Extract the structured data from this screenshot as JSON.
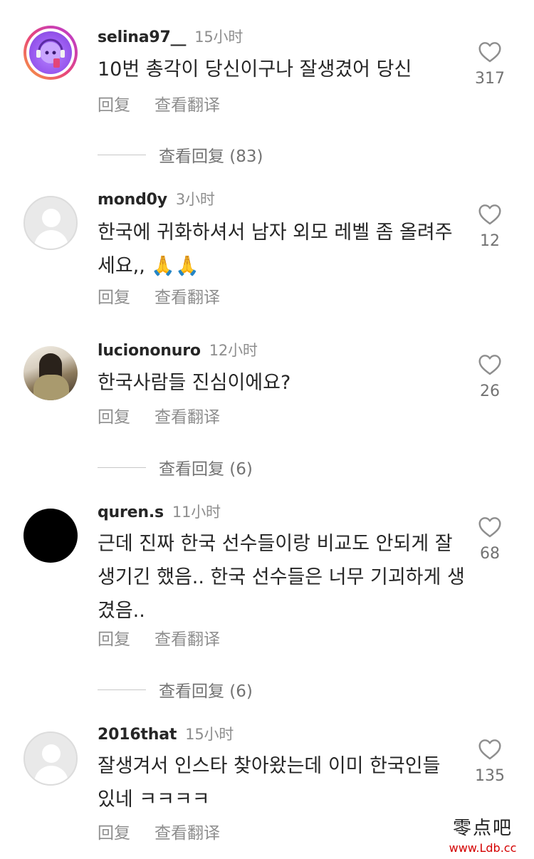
{
  "comments": [
    {
      "username": "selina97__",
      "time": "15小时",
      "text": "10번 총각이 당신이구나 잘생겼어 당신",
      "likes": "317",
      "reply_label": "回复",
      "translate_label": "查看翻译",
      "view_replies": "查看回复 (83)",
      "avatar_style": "purple-character-with-story-ring"
    },
    {
      "username": "mond0y",
      "time": "3小时",
      "text": "한국에 귀화하셔서 남자 외모 레벨 좀 올려주세요,, 🙏🙏",
      "likes": "12",
      "reply_label": "回复",
      "translate_label": "查看翻译",
      "avatar_style": "default-profile"
    },
    {
      "username": "luciononuro",
      "time": "12小时",
      "text": "한국사람들 진심이에요?",
      "likes": "26",
      "reply_label": "回复",
      "translate_label": "查看翻译",
      "view_replies": "查看回复 (6)",
      "avatar_style": "mirror-selfie-photo"
    },
    {
      "username": "quren.s",
      "time": "11小时",
      "text": "근데 진짜 한국 선수들이랑 비교도 안되게 잘생기긴 했음.. 한국 선수들은 너무 기괴하게 생겼음..",
      "likes": "68",
      "reply_label": "回复",
      "translate_label": "查看翻译",
      "view_replies": "查看回复 (6)",
      "avatar_style": "black-circle"
    },
    {
      "username": "2016that",
      "time": "15小时",
      "text": "잘생겨서 인스타 찾아왔는데 이미 한국인들 있네 ㅋㅋㅋㅋ",
      "likes": "135",
      "reply_label": "回复",
      "translate_label": "查看翻译",
      "avatar_style": "default-profile"
    }
  ],
  "icons": {
    "like": "heart-outline-icon"
  },
  "colors": {
    "text": "#262626",
    "secondary": "#8e8e8e",
    "watermark_url": "#d40000"
  },
  "watermark": {
    "name": "零点吧",
    "url": "www.Ldb.cc"
  }
}
